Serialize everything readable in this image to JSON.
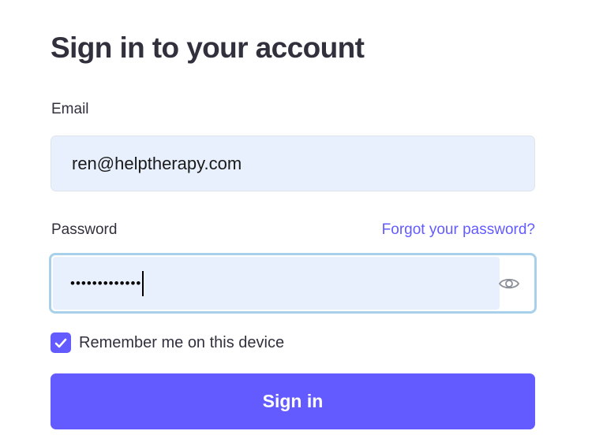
{
  "form": {
    "title": "Sign in to your account",
    "email_label": "Email",
    "email_value": "ren@helptherapy.com",
    "password_label": "Password",
    "forgot_link": "Forgot your password?",
    "password_masked": "•••••••••••••",
    "remember_label": "Remember me on this device",
    "remember_checked": true,
    "submit_label": "Sign in"
  },
  "icons": {
    "show_password": "eye-icon",
    "remember_check": "checkmark-icon"
  },
  "colors": {
    "accent": "#635bff",
    "text": "#30313d",
    "input_bg": "#e8f0fe",
    "focus_ring": "#a8d0ea"
  }
}
